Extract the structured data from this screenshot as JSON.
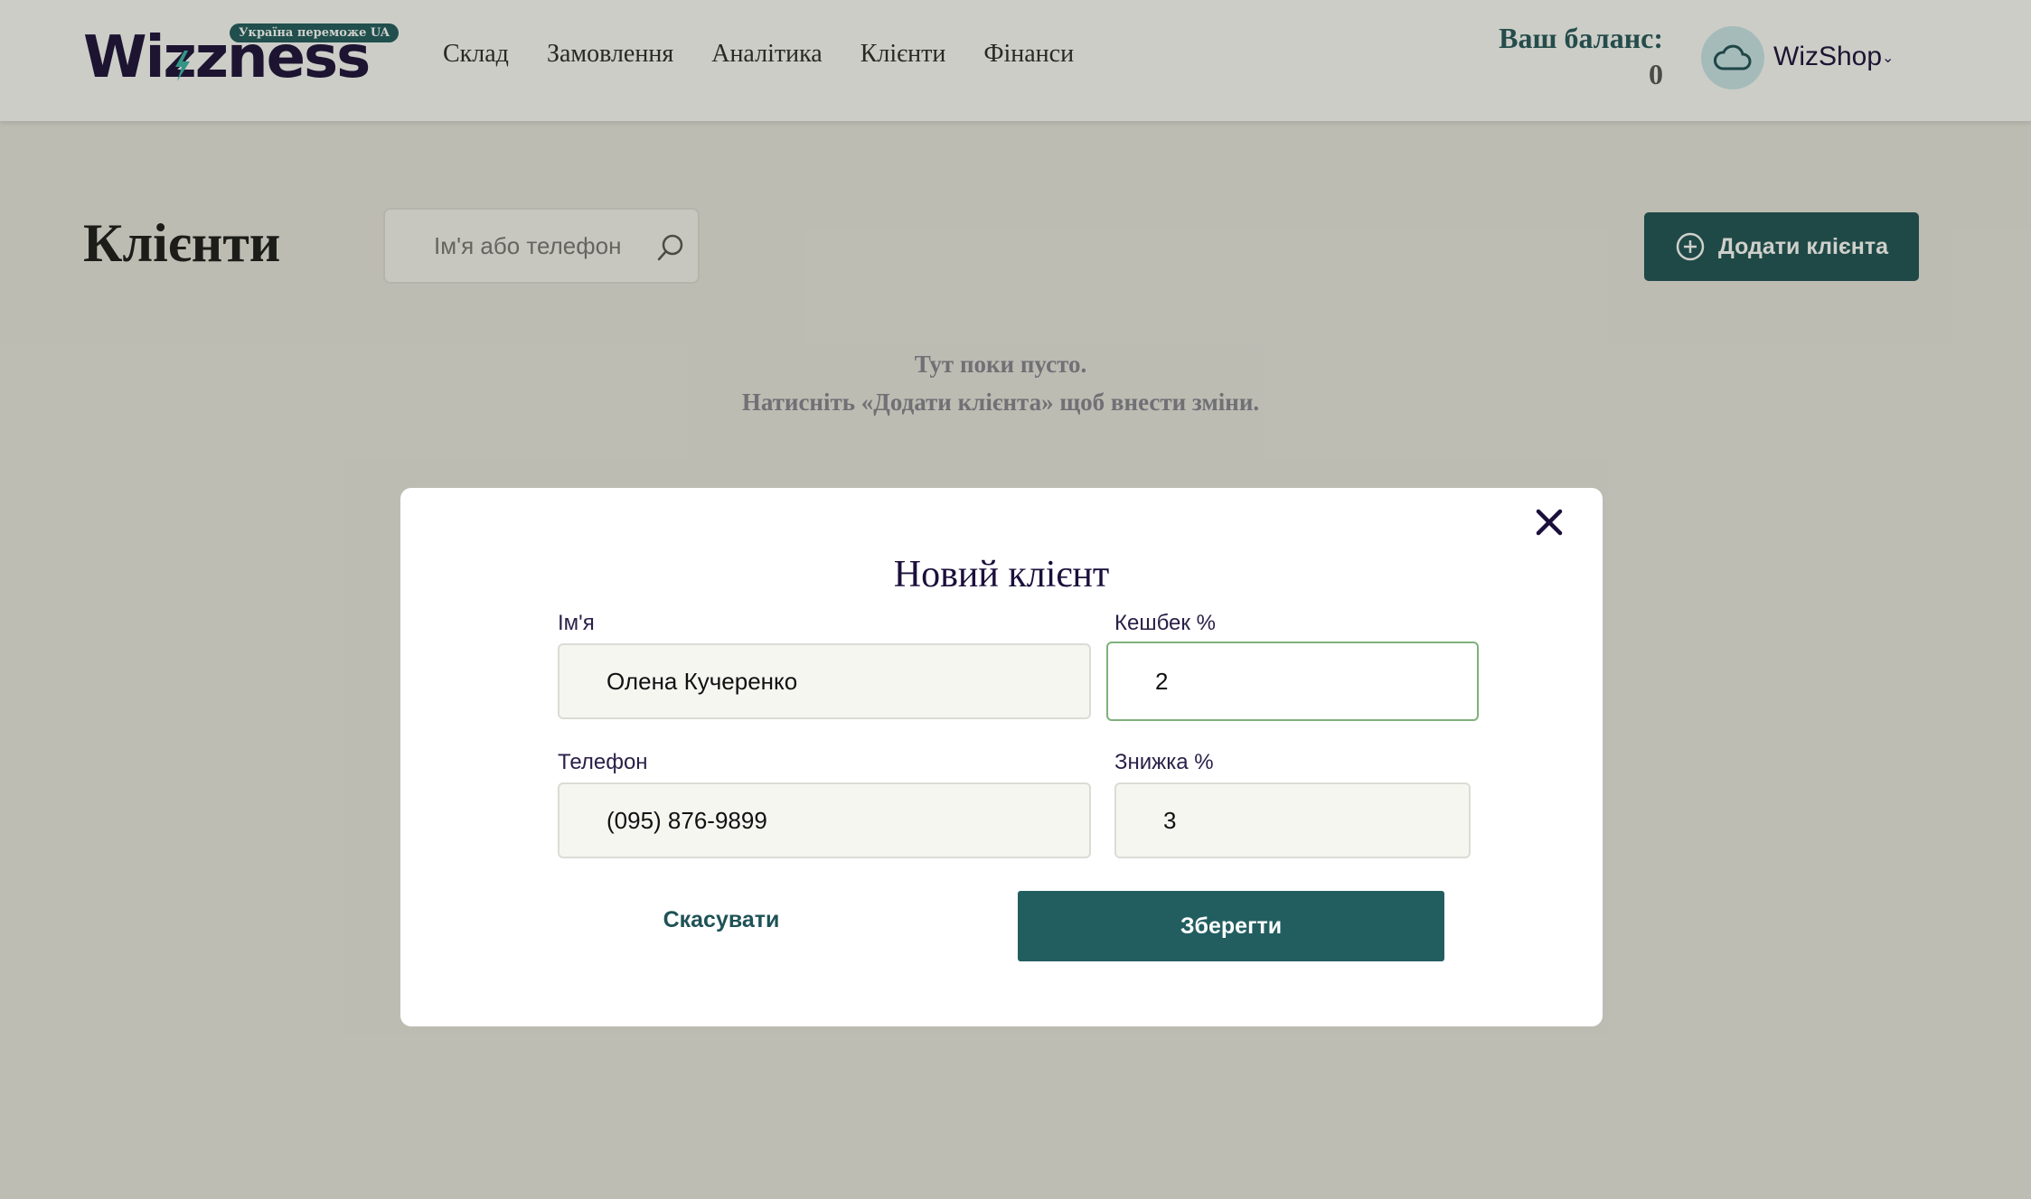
{
  "header": {
    "logo_text": "Wizzness",
    "logo_badge": "Україна переможе UA",
    "nav": [
      {
        "label": "Склад"
      },
      {
        "label": "Замовлення"
      },
      {
        "label": "Аналітика"
      },
      {
        "label": "Клієнти"
      },
      {
        "label": "Фінанси"
      }
    ],
    "balance_label": "Ваш баланс:",
    "balance_value": "0",
    "shop_name": "WizShop"
  },
  "page": {
    "title": "Клієнти",
    "search_placeholder": "Ім'я або телефон",
    "add_button": "Додати клієнта",
    "empty_line1": "Тут поки пусто.",
    "empty_line2": "Натисніть «Додати клієнта» щоб внести зміни."
  },
  "modal": {
    "title": "Новий клієнт",
    "name_label": "Ім'я",
    "name_value": "Олена Кучеренко",
    "cashback_label": "Кешбек %",
    "cashback_value": "2",
    "phone_label": "Телефон",
    "phone_value": "(095) 876-9899",
    "discount_label": "Знижка %",
    "discount_value": "3",
    "cancel_label": "Скасувати",
    "save_label": "Зберегти"
  },
  "colors": {
    "primary": "#1e5256",
    "logo": "#1b0f3b",
    "active_border": "#7fb07a"
  },
  "icons": [
    "lightning-icon",
    "search-icon",
    "plus-circle-icon",
    "cloud-icon",
    "chevron-down-icon",
    "close-icon"
  ]
}
